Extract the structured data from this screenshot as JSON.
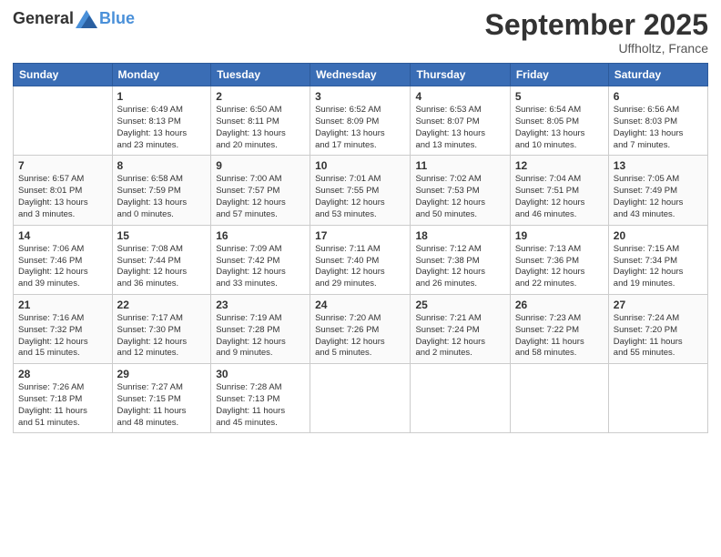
{
  "logo": {
    "general": "General",
    "blue": "Blue"
  },
  "header": {
    "month": "September 2025",
    "location": "Uffholtz, France"
  },
  "weekdays": [
    "Sunday",
    "Monday",
    "Tuesday",
    "Wednesday",
    "Thursday",
    "Friday",
    "Saturday"
  ],
  "weeks": [
    [
      {
        "day": "",
        "info": ""
      },
      {
        "day": "1",
        "info": "Sunrise: 6:49 AM\nSunset: 8:13 PM\nDaylight: 13 hours\nand 23 minutes."
      },
      {
        "day": "2",
        "info": "Sunrise: 6:50 AM\nSunset: 8:11 PM\nDaylight: 13 hours\nand 20 minutes."
      },
      {
        "day": "3",
        "info": "Sunrise: 6:52 AM\nSunset: 8:09 PM\nDaylight: 13 hours\nand 17 minutes."
      },
      {
        "day": "4",
        "info": "Sunrise: 6:53 AM\nSunset: 8:07 PM\nDaylight: 13 hours\nand 13 minutes."
      },
      {
        "day": "5",
        "info": "Sunrise: 6:54 AM\nSunset: 8:05 PM\nDaylight: 13 hours\nand 10 minutes."
      },
      {
        "day": "6",
        "info": "Sunrise: 6:56 AM\nSunset: 8:03 PM\nDaylight: 13 hours\nand 7 minutes."
      }
    ],
    [
      {
        "day": "7",
        "info": "Sunrise: 6:57 AM\nSunset: 8:01 PM\nDaylight: 13 hours\nand 3 minutes."
      },
      {
        "day": "8",
        "info": "Sunrise: 6:58 AM\nSunset: 7:59 PM\nDaylight: 13 hours\nand 0 minutes."
      },
      {
        "day": "9",
        "info": "Sunrise: 7:00 AM\nSunset: 7:57 PM\nDaylight: 12 hours\nand 57 minutes."
      },
      {
        "day": "10",
        "info": "Sunrise: 7:01 AM\nSunset: 7:55 PM\nDaylight: 12 hours\nand 53 minutes."
      },
      {
        "day": "11",
        "info": "Sunrise: 7:02 AM\nSunset: 7:53 PM\nDaylight: 12 hours\nand 50 minutes."
      },
      {
        "day": "12",
        "info": "Sunrise: 7:04 AM\nSunset: 7:51 PM\nDaylight: 12 hours\nand 46 minutes."
      },
      {
        "day": "13",
        "info": "Sunrise: 7:05 AM\nSunset: 7:49 PM\nDaylight: 12 hours\nand 43 minutes."
      }
    ],
    [
      {
        "day": "14",
        "info": "Sunrise: 7:06 AM\nSunset: 7:46 PM\nDaylight: 12 hours\nand 39 minutes."
      },
      {
        "day": "15",
        "info": "Sunrise: 7:08 AM\nSunset: 7:44 PM\nDaylight: 12 hours\nand 36 minutes."
      },
      {
        "day": "16",
        "info": "Sunrise: 7:09 AM\nSunset: 7:42 PM\nDaylight: 12 hours\nand 33 minutes."
      },
      {
        "day": "17",
        "info": "Sunrise: 7:11 AM\nSunset: 7:40 PM\nDaylight: 12 hours\nand 29 minutes."
      },
      {
        "day": "18",
        "info": "Sunrise: 7:12 AM\nSunset: 7:38 PM\nDaylight: 12 hours\nand 26 minutes."
      },
      {
        "day": "19",
        "info": "Sunrise: 7:13 AM\nSunset: 7:36 PM\nDaylight: 12 hours\nand 22 minutes."
      },
      {
        "day": "20",
        "info": "Sunrise: 7:15 AM\nSunset: 7:34 PM\nDaylight: 12 hours\nand 19 minutes."
      }
    ],
    [
      {
        "day": "21",
        "info": "Sunrise: 7:16 AM\nSunset: 7:32 PM\nDaylight: 12 hours\nand 15 minutes."
      },
      {
        "day": "22",
        "info": "Sunrise: 7:17 AM\nSunset: 7:30 PM\nDaylight: 12 hours\nand 12 minutes."
      },
      {
        "day": "23",
        "info": "Sunrise: 7:19 AM\nSunset: 7:28 PM\nDaylight: 12 hours\nand 9 minutes."
      },
      {
        "day": "24",
        "info": "Sunrise: 7:20 AM\nSunset: 7:26 PM\nDaylight: 12 hours\nand 5 minutes."
      },
      {
        "day": "25",
        "info": "Sunrise: 7:21 AM\nSunset: 7:24 PM\nDaylight: 12 hours\nand 2 minutes."
      },
      {
        "day": "26",
        "info": "Sunrise: 7:23 AM\nSunset: 7:22 PM\nDaylight: 11 hours\nand 58 minutes."
      },
      {
        "day": "27",
        "info": "Sunrise: 7:24 AM\nSunset: 7:20 PM\nDaylight: 11 hours\nand 55 minutes."
      }
    ],
    [
      {
        "day": "28",
        "info": "Sunrise: 7:26 AM\nSunset: 7:18 PM\nDaylight: 11 hours\nand 51 minutes."
      },
      {
        "day": "29",
        "info": "Sunrise: 7:27 AM\nSunset: 7:15 PM\nDaylight: 11 hours\nand 48 minutes."
      },
      {
        "day": "30",
        "info": "Sunrise: 7:28 AM\nSunset: 7:13 PM\nDaylight: 11 hours\nand 45 minutes."
      },
      {
        "day": "",
        "info": ""
      },
      {
        "day": "",
        "info": ""
      },
      {
        "day": "",
        "info": ""
      },
      {
        "day": "",
        "info": ""
      }
    ]
  ]
}
